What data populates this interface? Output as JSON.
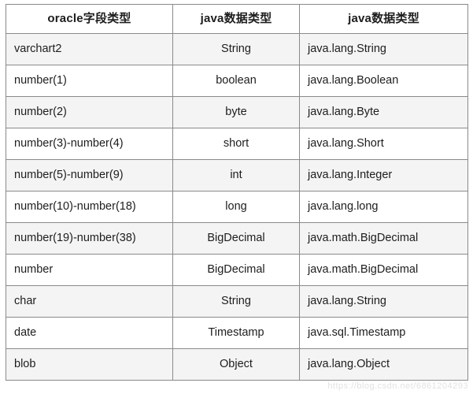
{
  "table": {
    "headers": [
      "oracle字段类型",
      "java数据类型",
      "java数据类型"
    ],
    "rows": [
      {
        "oracle_type": "varchart2",
        "java_type": "String",
        "java_class": "java.lang.String"
      },
      {
        "oracle_type": "number(1)",
        "java_type": "boolean",
        "java_class": "java.lang.Boolean"
      },
      {
        "oracle_type": "number(2)",
        "java_type": "byte",
        "java_class": "java.lang.Byte"
      },
      {
        "oracle_type": "number(3)-number(4)",
        "java_type": "short",
        "java_class": "java.lang.Short"
      },
      {
        "oracle_type": "number(5)-number(9)",
        "java_type": "int",
        "java_class": "java.lang.Integer"
      },
      {
        "oracle_type": "number(10)-number(18)",
        "java_type": "long",
        "java_class": "java.lang.long"
      },
      {
        "oracle_type": "number(19)-number(38)",
        "java_type": "BigDecimal",
        "java_class": "java.math.BigDecimal"
      },
      {
        "oracle_type": "number",
        "java_type": "BigDecimal",
        "java_class": "java.math.BigDecimal"
      },
      {
        "oracle_type": "char",
        "java_type": "String",
        "java_class": "java.lang.String"
      },
      {
        "oracle_type": "date",
        "java_type": "Timestamp",
        "java_class": "java.sql.Timestamp"
      },
      {
        "oracle_type": "blob",
        "java_type": "Object",
        "java_class": "java.lang.Object"
      }
    ]
  },
  "watermark": {
    "text": "https://blog.csdn.net/6861204293"
  },
  "colors": {
    "border": "#8a8a8a",
    "stripe_row": "#f4f4f4",
    "plain_row": "#ffffff",
    "text": "#1d1d1d",
    "watermark": "#e2e2e2"
  }
}
